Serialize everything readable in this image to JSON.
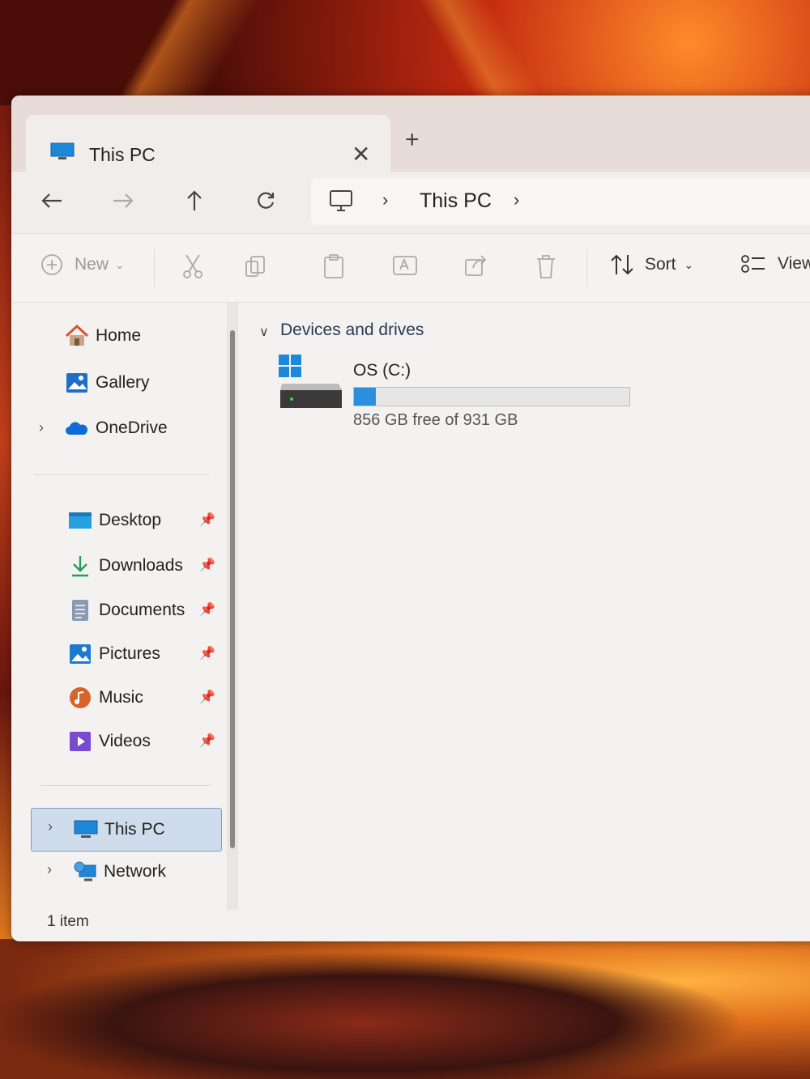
{
  "tab": {
    "title": "This PC",
    "close": "✕",
    "new": "+"
  },
  "address": {
    "location": "This PC",
    "sep": "›"
  },
  "commands": {
    "new_label": "New",
    "sort_label": "Sort",
    "view_label": "View"
  },
  "sidebar": {
    "top": [
      {
        "label": "Home"
      },
      {
        "label": "Gallery"
      },
      {
        "label": "OneDrive"
      }
    ],
    "pinned": [
      {
        "label": "Desktop"
      },
      {
        "label": "Downloads"
      },
      {
        "label": "Documents"
      },
      {
        "label": "Pictures"
      },
      {
        "label": "Music"
      },
      {
        "label": "Videos"
      }
    ],
    "bottom": [
      {
        "label": "This PC"
      },
      {
        "label": "Network"
      }
    ]
  },
  "main": {
    "group_label": "Devices and drives",
    "drive": {
      "name": "OS (C:)",
      "free_text": "856 GB free of 931 GB",
      "used_fraction": 0.08
    }
  },
  "status": {
    "items": "1 item"
  },
  "colors": {
    "accent": "#2b8fe0",
    "selection": "#cfdcec"
  }
}
